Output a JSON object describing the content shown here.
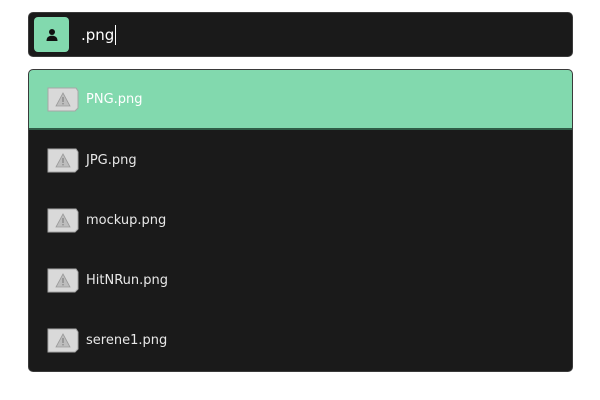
{
  "search": {
    "query": ".png",
    "mode_icon": "user-icon"
  },
  "results": [
    {
      "label": "PNG.png",
      "icon": "missing-image-icon",
      "selected": true
    },
    {
      "label": "JPG.png",
      "icon": "missing-image-icon",
      "selected": false
    },
    {
      "label": "mockup.png",
      "icon": "missing-image-icon",
      "selected": false
    },
    {
      "label": "HitNRun.png",
      "icon": "missing-image-icon",
      "selected": false
    },
    {
      "label": "serene1.png",
      "icon": "missing-image-icon",
      "selected": false
    }
  ],
  "colors": {
    "accent": "#82d9ae",
    "background": "#1a1a1a",
    "text": "#e8e8e8"
  }
}
